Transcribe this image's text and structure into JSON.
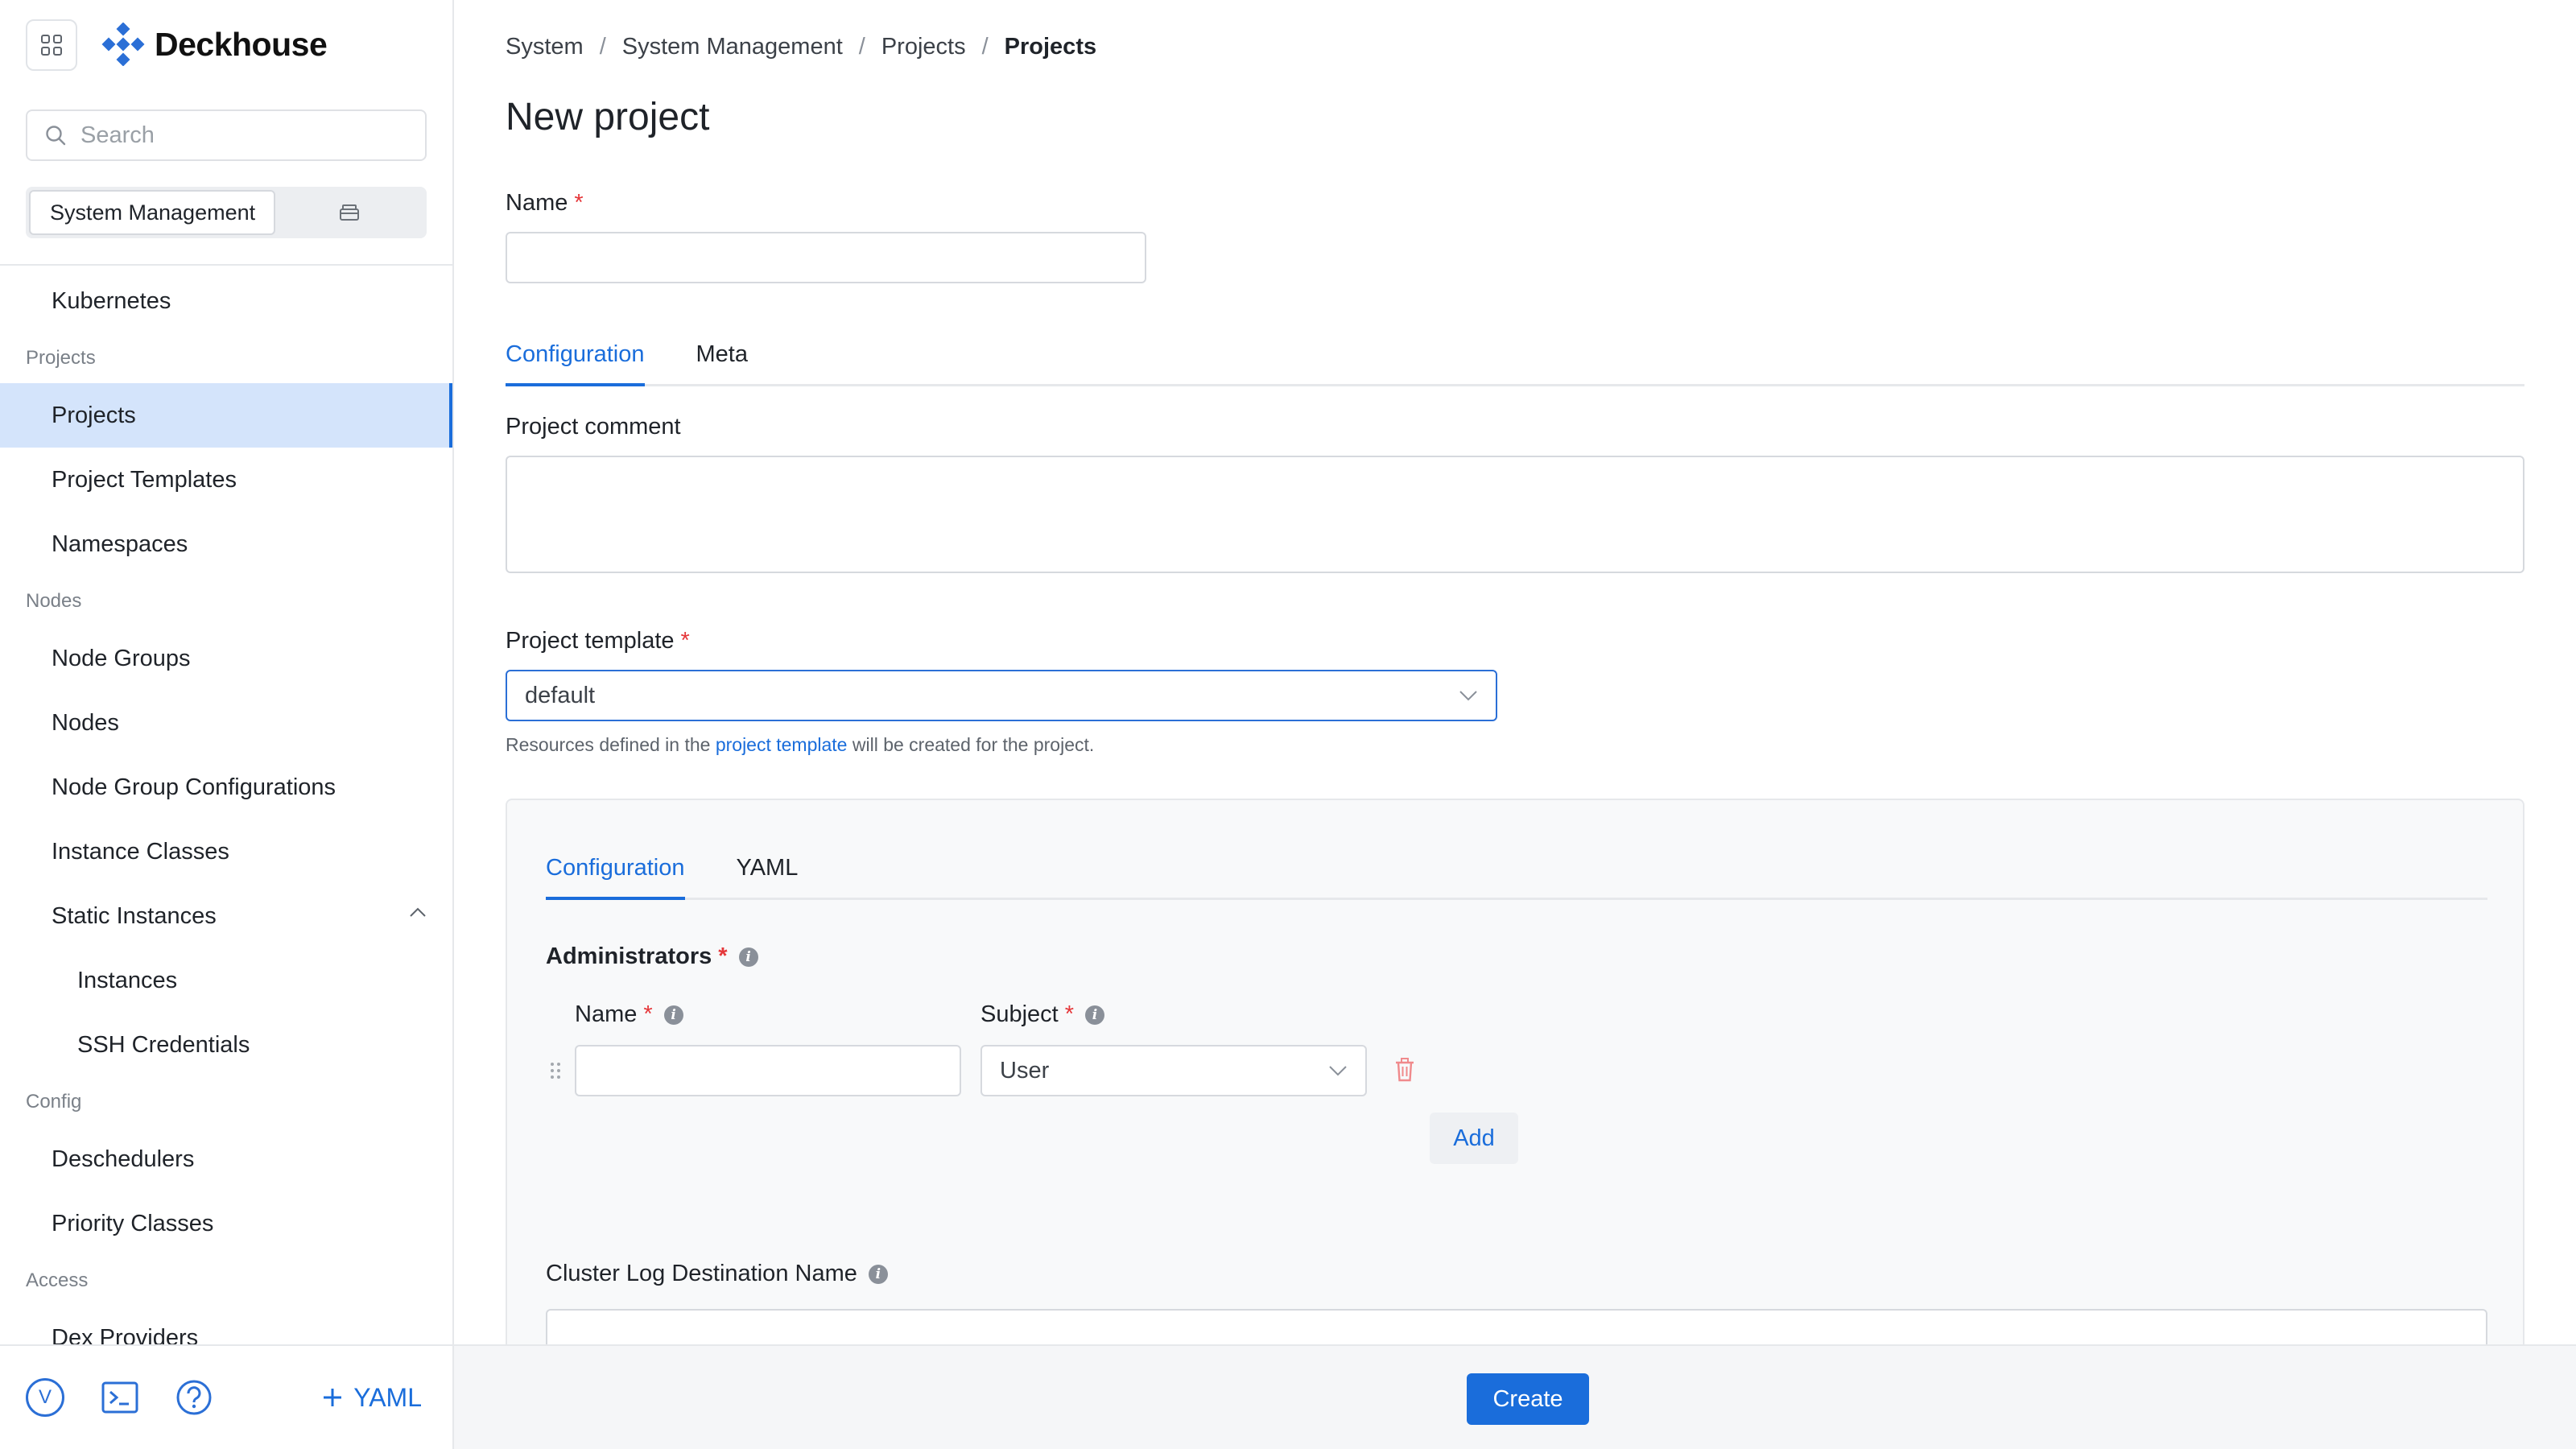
{
  "app": {
    "logo_text": "Deckhouse"
  },
  "sidebar": {
    "search_placeholder": "Search",
    "context_active": "System Management",
    "items": [
      {
        "type": "item",
        "label": "Kubernetes",
        "name": "sidebar-item-kubernetes"
      },
      {
        "type": "group",
        "label": "Projects"
      },
      {
        "type": "item",
        "label": "Projects",
        "name": "sidebar-item-projects",
        "active": true
      },
      {
        "type": "item",
        "label": "Project Templates",
        "name": "sidebar-item-project-templates"
      },
      {
        "type": "item",
        "label": "Namespaces",
        "name": "sidebar-item-namespaces"
      },
      {
        "type": "group",
        "label": "Nodes"
      },
      {
        "type": "item",
        "label": "Node Groups",
        "name": "sidebar-item-node-groups"
      },
      {
        "type": "item",
        "label": "Nodes",
        "name": "sidebar-item-nodes"
      },
      {
        "type": "item",
        "label": "Node Group Configurations",
        "name": "sidebar-item-node-group-configurations"
      },
      {
        "type": "item",
        "label": "Instance Classes",
        "name": "sidebar-item-instance-classes"
      },
      {
        "type": "item",
        "label": "Static Instances",
        "name": "sidebar-item-static-instances",
        "expanded": true
      },
      {
        "type": "sub",
        "label": "Instances",
        "name": "sidebar-item-instances"
      },
      {
        "type": "sub",
        "label": "SSH Credentials",
        "name": "sidebar-item-ssh-credentials"
      },
      {
        "type": "group",
        "label": "Config"
      },
      {
        "type": "item",
        "label": "Deschedulers",
        "name": "sidebar-item-deschedulers"
      },
      {
        "type": "item",
        "label": "Priority Classes",
        "name": "sidebar-item-priority-classes"
      },
      {
        "type": "group",
        "label": "Access"
      },
      {
        "type": "item",
        "label": "Dex Providers",
        "name": "sidebar-item-dex-providers"
      }
    ],
    "footer": {
      "avatar_letter": "V",
      "yaml_label": "YAML"
    }
  },
  "breadcrumb": {
    "items": [
      "System",
      "System Management",
      "Projects"
    ],
    "current": "Projects"
  },
  "page": {
    "title": "New project",
    "name_label": "Name",
    "name_value": "",
    "tabs": [
      "Configuration",
      "Meta"
    ],
    "comment_label": "Project comment",
    "template_label": "Project template",
    "template_value": "default",
    "hint_before": "Resources defined in the ",
    "hint_link": "project template",
    "hint_after": " will be created for the project."
  },
  "panel": {
    "tabs": [
      "Configuration",
      "YAML"
    ],
    "administrators_label": "Administrators",
    "col_name": "Name",
    "col_subject": "Subject",
    "subject_value": "User",
    "add_label": "Add",
    "log_dest_label": "Cluster Log Destination Name"
  },
  "footer": {
    "create_label": "Create"
  },
  "colors": {
    "accent": "#1a6ddb",
    "active_bg": "#d4e4fb",
    "required": "#e5373a",
    "danger": "#f08a8c"
  }
}
